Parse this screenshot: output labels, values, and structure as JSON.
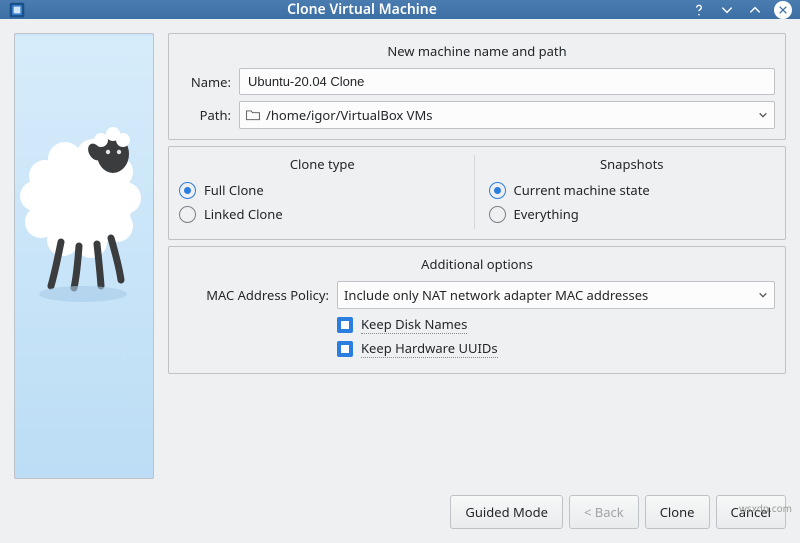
{
  "titlebar": {
    "title": "Clone Virtual Machine"
  },
  "group_name": {
    "title": "New machine name and path",
    "name_label": "Name:",
    "name_value": "Ubuntu-20.04 Clone",
    "path_label": "Path:",
    "path_value": "/home/igor/VirtualBox VMs"
  },
  "clone_type": {
    "title": "Clone type",
    "full": "Full Clone",
    "linked": "Linked Clone"
  },
  "snapshots": {
    "title": "Snapshots",
    "current": "Current machine state",
    "everything": "Everything"
  },
  "additional": {
    "title": "Additional options",
    "mac_label": "MAC Address Policy:",
    "mac_value": "Include only NAT network adapter MAC addresses",
    "keep_disk": "Keep Disk Names",
    "keep_uuid": "Keep Hardware UUIDs"
  },
  "buttons": {
    "guided": "Guided Mode",
    "back": "< Back",
    "clone": "Clone",
    "cancel": "Cancel"
  },
  "watermark": "wsxdn.com"
}
